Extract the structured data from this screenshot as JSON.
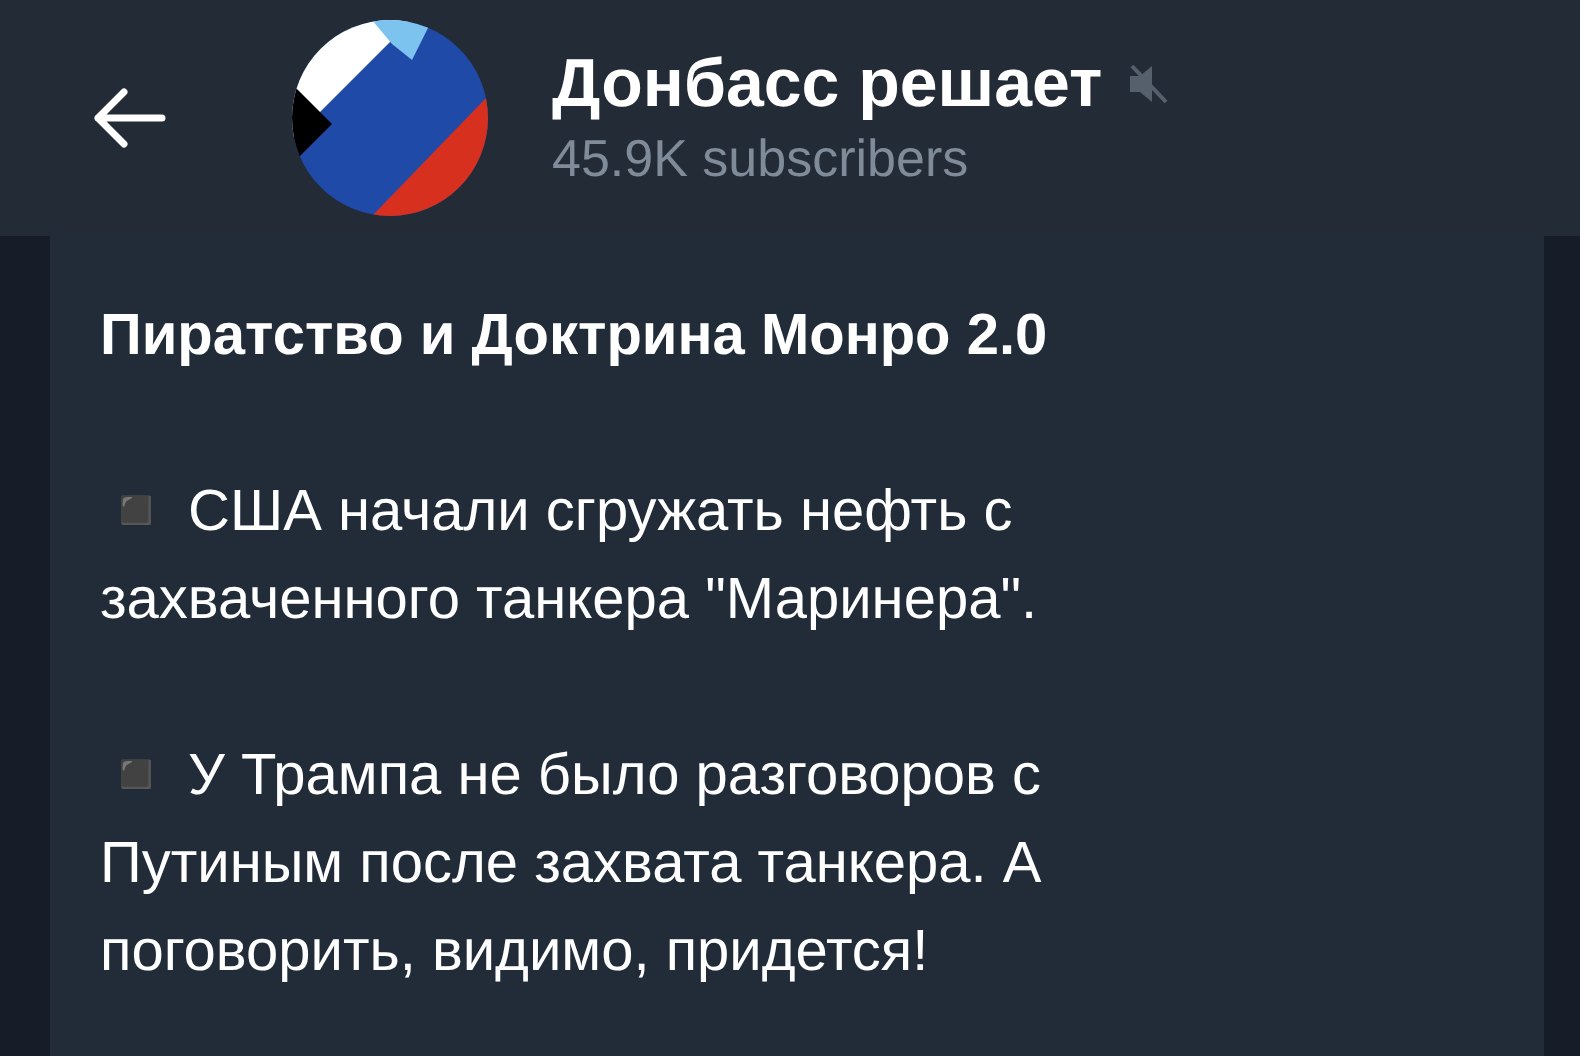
{
  "header": {
    "channel_name": "Донбасс решает",
    "subscribers": "45.9K subscribers",
    "muted": true
  },
  "message": {
    "title": "Пиратство и Доктрина Монро 2.0",
    "paragraphs": [
      "◾ США начали сгружать нефть с захваченного танкера \"Маринера\".",
      "◾ У Трампа не было разговоров с Путиным после захвата танкера. А поговорить, видимо, придется!"
    ]
  }
}
